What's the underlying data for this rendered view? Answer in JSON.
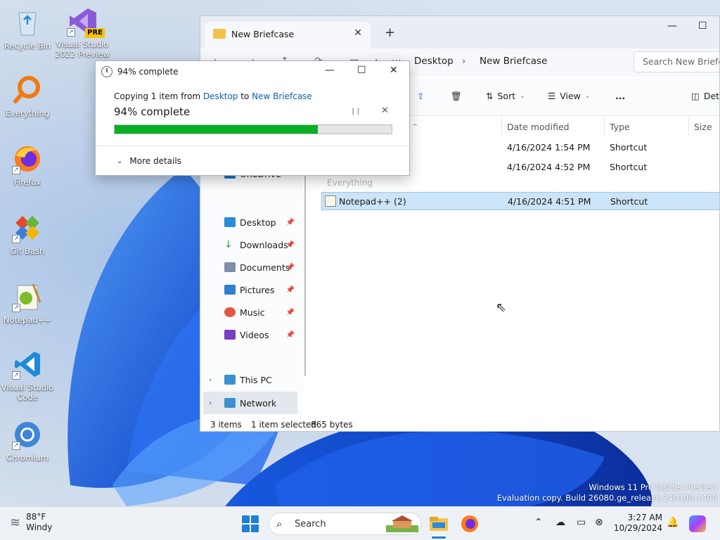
{
  "desktop": {
    "icons": [
      {
        "label": "Recycle Bin"
      },
      {
        "label": "Visual Studio 2022 Preview",
        "badge": "PRE"
      },
      {
        "label": "Everything"
      },
      {
        "label": "Firefox"
      },
      {
        "label": "Git Bash"
      },
      {
        "label": "Notepad++"
      },
      {
        "label": "Visual Studio Code"
      },
      {
        "label": "Chromium"
      }
    ],
    "watermark_line1": "Windows 11 Pro Insider Preview",
    "watermark_line2": "Evaluation copy. Build 26080.ge_release.240308-1400"
  },
  "explorer": {
    "tab_title": "New Briefcase",
    "breadcrumb": [
      "Desktop",
      "New Briefcase"
    ],
    "search_placeholder": "Search New Briefcase",
    "toolbar": {
      "sort": "Sort",
      "view": "View",
      "more": "...",
      "details": "Details"
    },
    "sidebar": [
      {
        "label": "OneDrive",
        "color": "#1a73c9"
      },
      {
        "label": "Desktop",
        "color": "#2b8bd6",
        "pin": true
      },
      {
        "label": "Downloads",
        "color": "#2b9a3a",
        "pin": true
      },
      {
        "label": "Documents",
        "color": "#7d8fa6",
        "pin": true
      },
      {
        "label": "Pictures",
        "color": "#2f7fd0",
        "pin": true
      },
      {
        "label": "Music",
        "color": "#e2583e",
        "pin": true
      },
      {
        "label": "Videos",
        "color": "#7b3fc2",
        "pin": true
      },
      {
        "label": "This PC",
        "color": "#3d8fd1"
      },
      {
        "label": "Network",
        "color": "#3d8fd1"
      }
    ],
    "columns": {
      "date": "Date modified",
      "type": "Type",
      "size": "Size"
    },
    "rows": [
      {
        "name": "",
        "date": "4/16/2024 1:54 PM",
        "type": "Shortcut"
      },
      {
        "name": "",
        "date": "4/16/2024 4:52 PM",
        "type": "Shortcut"
      },
      {
        "name": "Notepad++ (2)",
        "date": "4/16/2024 4:51 PM",
        "type": "Shortcut"
      }
    ],
    "ghost_label": "Everything",
    "status": {
      "count": "3 items",
      "selected": "1 item selected",
      "size": "865 bytes"
    }
  },
  "dialog": {
    "title": "94% complete",
    "copy_prefix": "Copying 1 item from ",
    "from": "Desktop",
    "to_word": " to ",
    "to": "New Briefcase",
    "percent_text": "94% complete",
    "progress_fraction": 0.94,
    "more_details": "More details"
  },
  "taskbar": {
    "temp": "88°F",
    "condition": "Windy",
    "search_label": "Search",
    "time": "3:27 AM",
    "date": "10/29/2024"
  }
}
